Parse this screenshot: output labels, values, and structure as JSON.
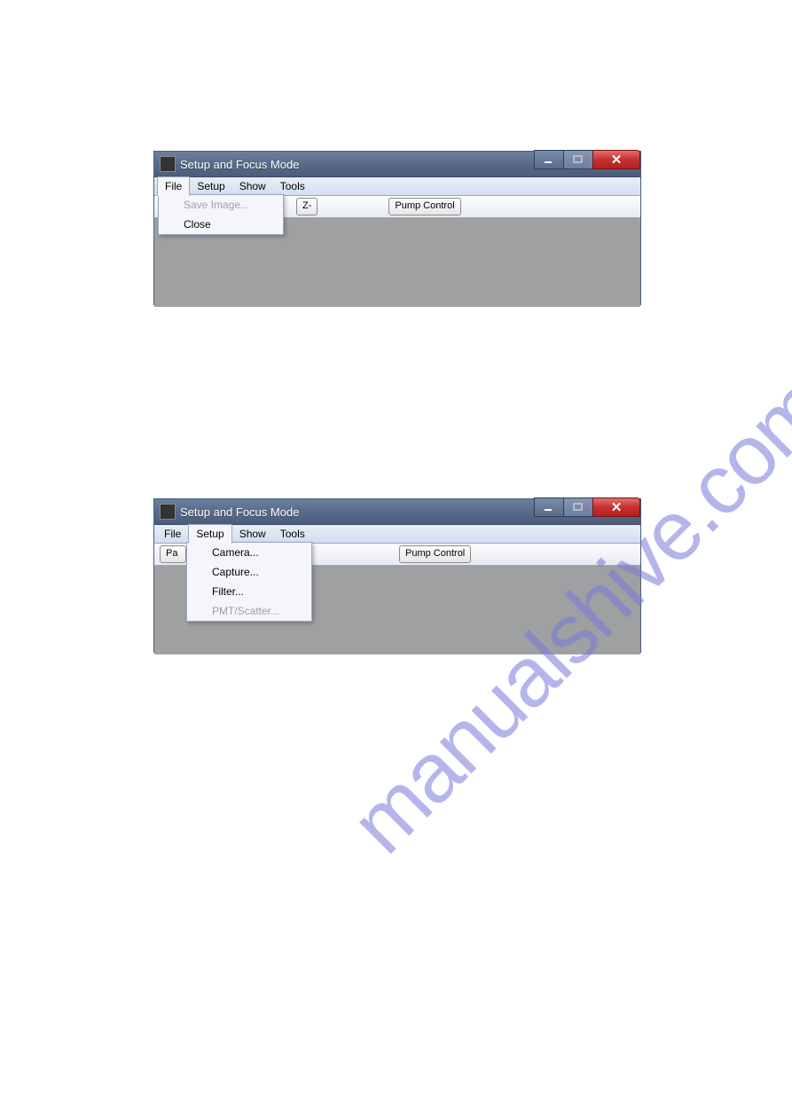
{
  "watermark": "manualshive.com",
  "window1": {
    "title": "Setup and Focus Mode",
    "menubar": {
      "file": "File",
      "setup": "Setup",
      "show": "Show",
      "tools": "Tools"
    },
    "active_menu": "File",
    "dropdown": {
      "save_image": "Save Image...",
      "close": "Close"
    },
    "toolbar": {
      "z_minus": "Z-",
      "pump_control": "Pump Control"
    }
  },
  "window2": {
    "title": "Setup and Focus Mode",
    "menubar": {
      "file": "File",
      "setup": "Setup",
      "show": "Show",
      "tools": "Tools"
    },
    "active_menu": "Setup",
    "dropdown": {
      "camera": "Camera...",
      "capture": "Capture...",
      "filter": "Filter...",
      "pmt_scatter": "PMT/Scatter..."
    },
    "toolbar": {
      "pa_fragment": "Pa",
      "pump_control": "Pump Control"
    }
  }
}
